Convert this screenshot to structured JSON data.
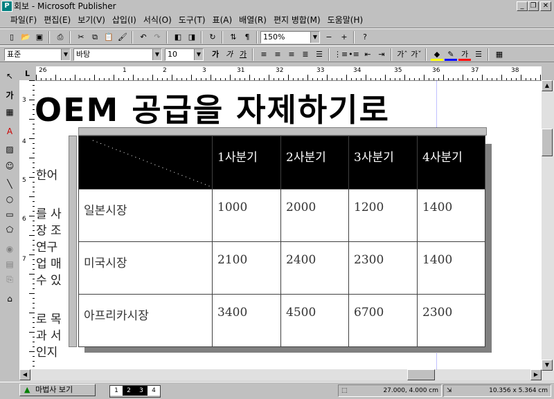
{
  "window": {
    "title": "회보 - Microsoft Publisher",
    "app_icon": "P"
  },
  "menu": [
    "파일(F)",
    "편집(E)",
    "보기(V)",
    "삽입(I)",
    "서식(O)",
    "도구(T)",
    "표(A)",
    "배열(R)",
    "편지 병합(M)",
    "도움말(H)"
  ],
  "standard_toolbar": {
    "zoom": "150%"
  },
  "format_toolbar": {
    "style": "표준",
    "font": "바탕",
    "size": "10"
  },
  "document": {
    "headline": "OEM 공급을 자제하기로",
    "body_fragments": [
      "한어",
      "를 사",
      "장 조",
      "연구",
      "업 매",
      "수 있",
      "로 목",
      "과 서",
      "인지"
    ]
  },
  "table": {
    "header": [
      "",
      "1사분기",
      "2사분기",
      "3사분기",
      "4사분기"
    ],
    "rows": [
      [
        "일본시장",
        "1000",
        "2000",
        "1200",
        "1400"
      ],
      [
        "미국시장",
        "2100",
        "2400",
        "2300",
        "1400"
      ],
      [
        "아프리카시장",
        "3400",
        "4500",
        "6700",
        "2300"
      ]
    ]
  },
  "rulers": {
    "horizontal": [
      "26",
      "1",
      "2",
      "3",
      "31",
      "32",
      "33",
      "34",
      "35",
      "36",
      "37",
      "38"
    ],
    "vertical": [
      "3",
      "4",
      "5",
      "6",
      "7"
    ]
  },
  "statusbar": {
    "wizard_button": "마법사 보기",
    "pages": [
      "1",
      "2",
      "3",
      "4"
    ],
    "position": "27.000, 4.000 cm",
    "size": "10.356 x  5.364 cm"
  },
  "colors": {
    "chrome": "#c0c0c0",
    "table_header_bg": "#000000",
    "table_header_text": "#ffffff"
  }
}
